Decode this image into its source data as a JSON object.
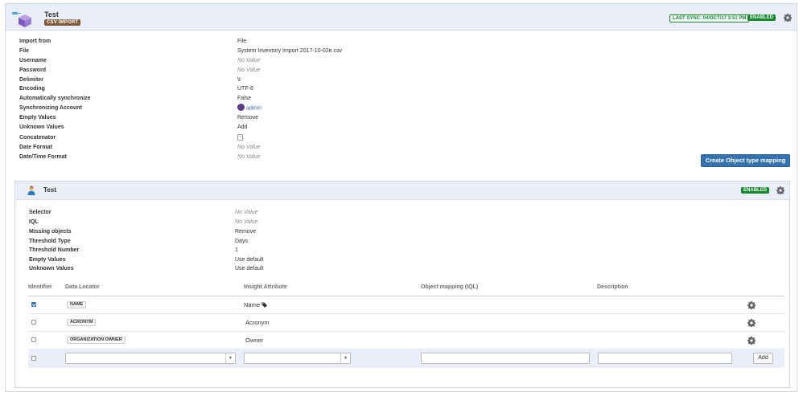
{
  "import": {
    "title": "Test",
    "type_badge": "CSV IMPORT",
    "last_sync": "LAST SYNC: 04/OCT/17 3:51 PM",
    "status": "ENABLED",
    "config": [
      {
        "label": "Import from",
        "value": "File"
      },
      {
        "label": "File",
        "value": "System Inventory Import 2017-10-02e.csv"
      },
      {
        "label": "Username",
        "value": "No Value"
      },
      {
        "label": "Password",
        "value": "No Value"
      },
      {
        "label": "Delimiter",
        "value": "\\t"
      },
      {
        "label": "Encoding",
        "value": "UTF-8"
      },
      {
        "label": "Automatically synchronize",
        "value": "False"
      },
      {
        "label": "Synchronizing Account",
        "value": "admin"
      },
      {
        "label": "Empty Values",
        "value": "Remove"
      },
      {
        "label": "Unknown Values",
        "value": "Add"
      },
      {
        "label": "Concatenator",
        "value": "-"
      },
      {
        "label": "Date Format",
        "value": "No Value"
      },
      {
        "label": "Date/Time Format",
        "value": "No Value"
      }
    ],
    "create_button": "Create Object type mapping"
  },
  "mapping": {
    "title": "Test",
    "status": "ENABLED",
    "config": [
      {
        "label": "Selector",
        "value": "No Value"
      },
      {
        "label": "IQL",
        "value": "No Value"
      },
      {
        "label": "Missing objects",
        "value": "Remove"
      },
      {
        "label": "Threshold Type",
        "value": "Days"
      },
      {
        "label": "Threshold Number",
        "value": "1"
      },
      {
        "label": "Empty Values",
        "value": "Use default"
      },
      {
        "label": "Unknown Values",
        "value": "Use default"
      }
    ],
    "table": {
      "headers": [
        "Identifier",
        "Data Locator",
        "Insight Attribute",
        "Object mapping (IQL)",
        "Description"
      ],
      "rows": [
        {
          "identifier": true,
          "locator": "NAME",
          "attribute": "Name"
        },
        {
          "identifier": false,
          "locator": "ACRONYM",
          "attribute": "Acronym"
        },
        {
          "identifier": false,
          "locator": "ORGANIZATION OWNER",
          "attribute": "Owner"
        }
      ],
      "add_button": "Add"
    }
  },
  "colors": {
    "header_bg": "#e9eef8",
    "enabled_green": "#14892c",
    "csv_brown": "#815b3a",
    "primary_blue": "#3572b0"
  },
  "icons": [
    "import-box-icon",
    "gear-icon",
    "person-icon",
    "tag-icon",
    "avatar-icon",
    "chevron-down-icon"
  ]
}
